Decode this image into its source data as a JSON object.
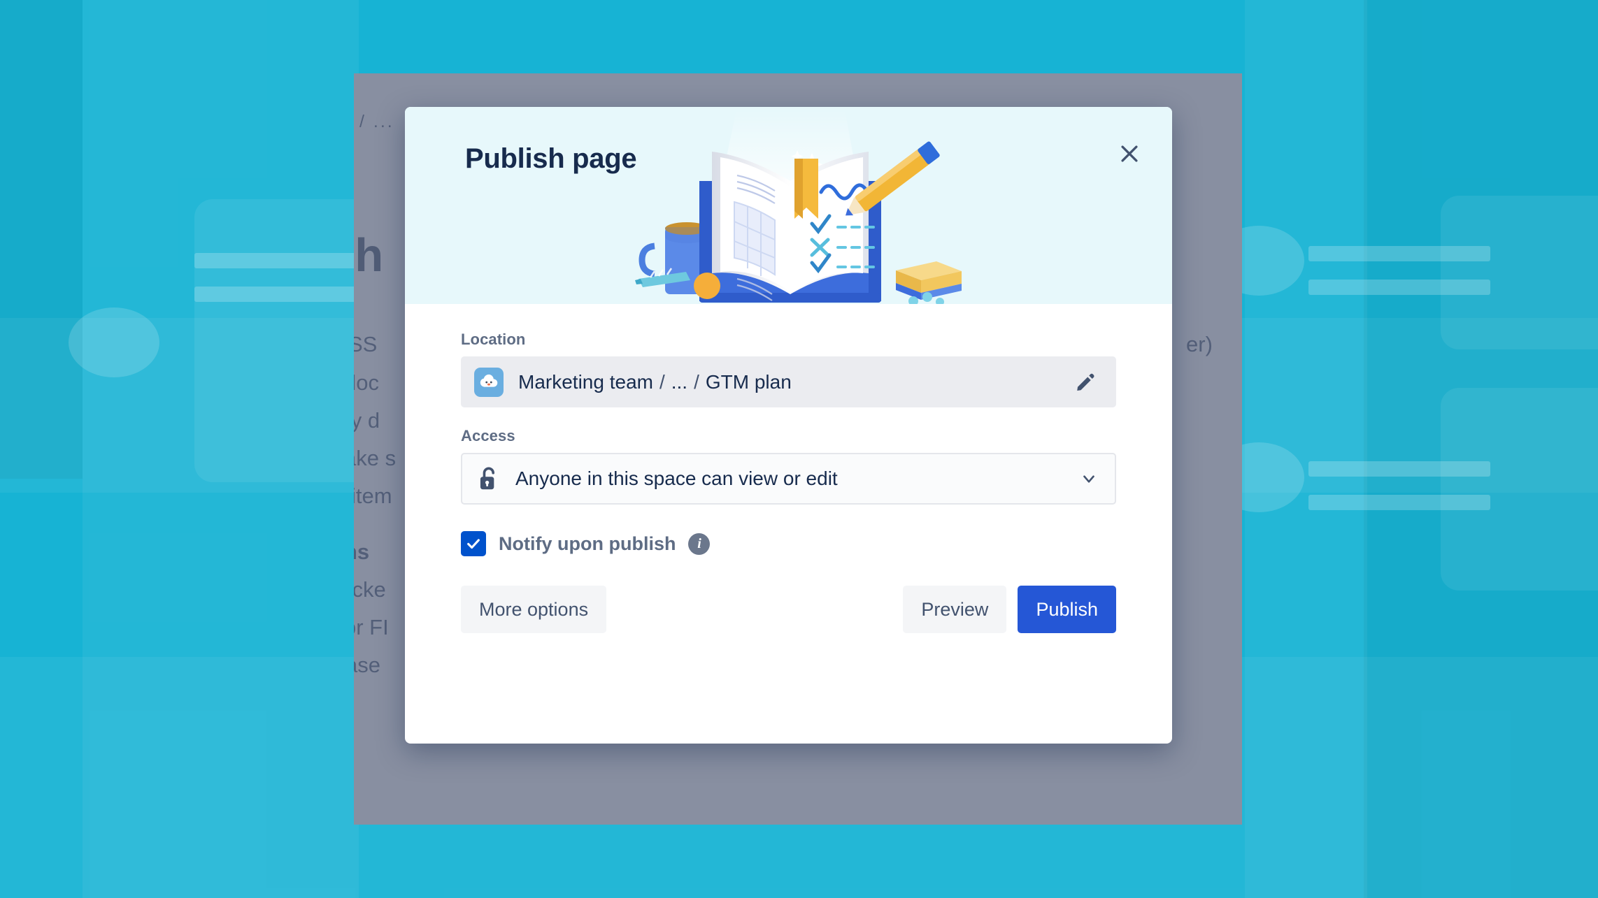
{
  "modal": {
    "title": "Publish page",
    "close_icon": "close-icon",
    "hero_illustration": "open-book-with-pencil-illustration",
    "location": {
      "label": "Location",
      "space_avatar_icon": "cloud-mascot-avatar-icon",
      "space_name": "Marketing team",
      "separator": "/",
      "ellipsis": "...",
      "page_name": "GTM plan",
      "edit_icon": "pencil-icon"
    },
    "access": {
      "label": "Access",
      "lock_icon": "unlocked-padlock-icon",
      "selected_option": "Anyone in this space can view or edit",
      "chevron_icon": "chevron-down-icon"
    },
    "notify": {
      "checked": true,
      "check_icon": "checkmark-icon",
      "label": "Notify upon publish",
      "info_icon": "info-icon",
      "info_glyph": "i"
    },
    "footer": {
      "more_options_label": "More options",
      "preview_label": "Preview",
      "publish_label": "Publish"
    }
  },
  "background_page": {
    "breadcrumb": "/ ...",
    "title": "sh",
    "body_lines": [
      "SS",
      "doc",
      "lly d",
      "ake s",
      "item",
      "ns",
      "ticke",
      "or FI",
      "ase"
    ],
    "right_fragment": "er)"
  },
  "colors": {
    "backdrop_teal": "#17b3d4",
    "modal_header": "#e7f8fb",
    "primary_blue": "#2557d6",
    "checkbox_blue": "#0052cc",
    "text_navy": "#172b4d",
    "label_gray": "#5e6c84",
    "field_gray": "#ebecf0",
    "scrim": "rgba(99,108,132,0.76)"
  }
}
